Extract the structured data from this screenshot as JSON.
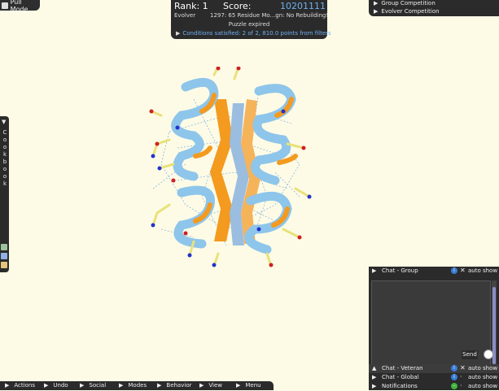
{
  "pull_mode": {
    "label": "Pull Mode"
  },
  "score_panel": {
    "rank": "Rank: 1",
    "score_label": "Score:",
    "score_value": "10201111",
    "group": "Evolver",
    "puzzle": "1297: 65 Residue Mo...gn: No Rebuilding!",
    "status": "Puzzle expired",
    "conditions": "Conditions satisfied: 2 of 2, 810.0 points from filters"
  },
  "competitions": [
    {
      "label": "Group Competition"
    },
    {
      "label": "Evolver Competition"
    }
  ],
  "cookbook": {
    "label": "Cookbook",
    "letters": [
      "C",
      "o",
      "o",
      "k",
      "b",
      "o",
      "o",
      "k"
    ]
  },
  "chat": {
    "group": {
      "title": "Chat - Group",
      "auto": "auto show"
    },
    "send": "Send",
    "veteran": {
      "title": "Chat - Veteran",
      "auto": "auto show"
    },
    "global": {
      "title": "Chat - Global",
      "auto": "auto show"
    },
    "notifications": {
      "title": "Notifications",
      "auto": "auto show"
    }
  },
  "bottom_menu": [
    "Actions",
    "Undo",
    "Social",
    "Modes",
    "Behavior",
    "View",
    "Menu"
  ],
  "colors": {
    "background": "#fdfbe6",
    "panel": "#2b2b2b",
    "accent_blue": "#6fb0f0",
    "helix": "#8ec5ea",
    "sheet": "#f39a1f",
    "sidechain": "#e8e27a"
  }
}
